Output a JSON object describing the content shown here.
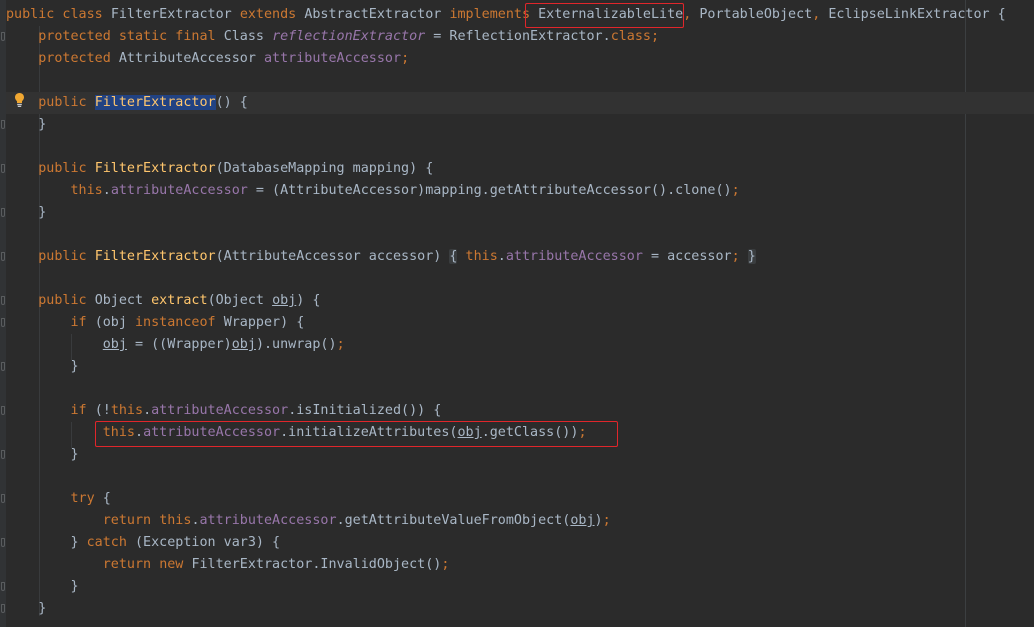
{
  "editor": {
    "line_numbers_visible": false,
    "colors": {
      "background": "#2b2b2b",
      "keyword": "#cc7832",
      "method": "#ffc66d",
      "field": "#9876aa",
      "text": "#a9b7c6",
      "highlight_box": "#e0262b"
    },
    "lines": {
      "l1_kw": "public class ",
      "l1_name": "FilterExtractor ",
      "l1_ext": "extends ",
      "l1_base": "AbstractExtractor ",
      "l1_impl": "implements ",
      "l1_iface1": "ExternalizableLite",
      "l1_comma": ",",
      "l1_rest": " PortableObject",
      "l1_comma2": ",",
      "l1_rest2": " EclipseLinkExtractor {",
      "l2_kw": "protected static final ",
      "l2_type": "Class ",
      "l2_field": "reflectionExtractor",
      "l2_eq": " = ReflectionExtractor.",
      "l2_class": "class",
      "l2_semi": ";",
      "l3_kw": "protected ",
      "l3_type": "AttributeAccessor ",
      "l3_field": "attributeAccessor",
      "l3_semi": ";",
      "l4_kw": "public ",
      "l4_name": "FilterExtractor",
      "l4_rest": "() {",
      "l5": "}",
      "l6_kw": "public ",
      "l6_name": "FilterExtractor",
      "l6_rest": "(DatabaseMapping mapping) {",
      "l7_this": "this",
      "l7_dot": ".",
      "l7_field": "attributeAccessor",
      "l7_rest": " = (AttributeAccessor)mapping.getAttributeAccessor().clone()",
      "l7_semi": ";",
      "l8": "}",
      "l9_kw": "public ",
      "l9_name": "FilterExtractor",
      "l9_args": "(AttributeAccessor accessor) ",
      "l9_open": "{",
      "l9_sp": " ",
      "l9_this": "this",
      "l9_dot": ".",
      "l9_field": "attributeAccessor",
      "l9_eq": " = accessor",
      "l9_semi": ";",
      "l9_sp2": " ",
      "l9_close": "}",
      "l10_kw": "public ",
      "l10_type": "Object ",
      "l10_name": "extract",
      "l10_open": "(Object ",
      "l10_param": "obj",
      "l10_rest": ") {",
      "l11_if": "if ",
      "l11_open": "(obj ",
      "l11_inst": "instanceof ",
      "l11_rest": "Wrapper) {",
      "l12_obj": "obj",
      "l12_mid": " = ((Wrapper)",
      "l12_obj2": "obj",
      "l12_rest": ").unwrap()",
      "l12_semi": ";",
      "l13": "}",
      "l14_if": "if ",
      "l14_open": "(!",
      "l14_this": "this",
      "l14_dot": ".",
      "l14_field": "attributeAccessor",
      "l14_rest": ".isInitialized()) {",
      "l15_this": "this",
      "l15_dot": ".",
      "l15_field": "attributeAccessor",
      "l15_mid": ".initializeAttributes(",
      "l15_obj": "obj",
      "l15_rest": ".getClass())",
      "l15_semi": ";",
      "l16": "}",
      "l17_try": "try ",
      "l17_rest": "{",
      "l18_ret": "return ",
      "l18_this": "this",
      "l18_dot": ".",
      "l18_field": "attributeAccessor",
      "l18_mid": ".getAttributeValueFromObject(",
      "l18_obj": "obj",
      "l18_rest": ")",
      "l18_semi": ";",
      "l19_close": "} ",
      "l19_catch": "catch ",
      "l19_rest": "(Exception var3) {",
      "l20_ret": "return ",
      "l20_new": "new ",
      "l20_rest": "FilterExtractor.InvalidObject()",
      "l20_semi": ";",
      "l21": "}",
      "l22": "}"
    }
  }
}
